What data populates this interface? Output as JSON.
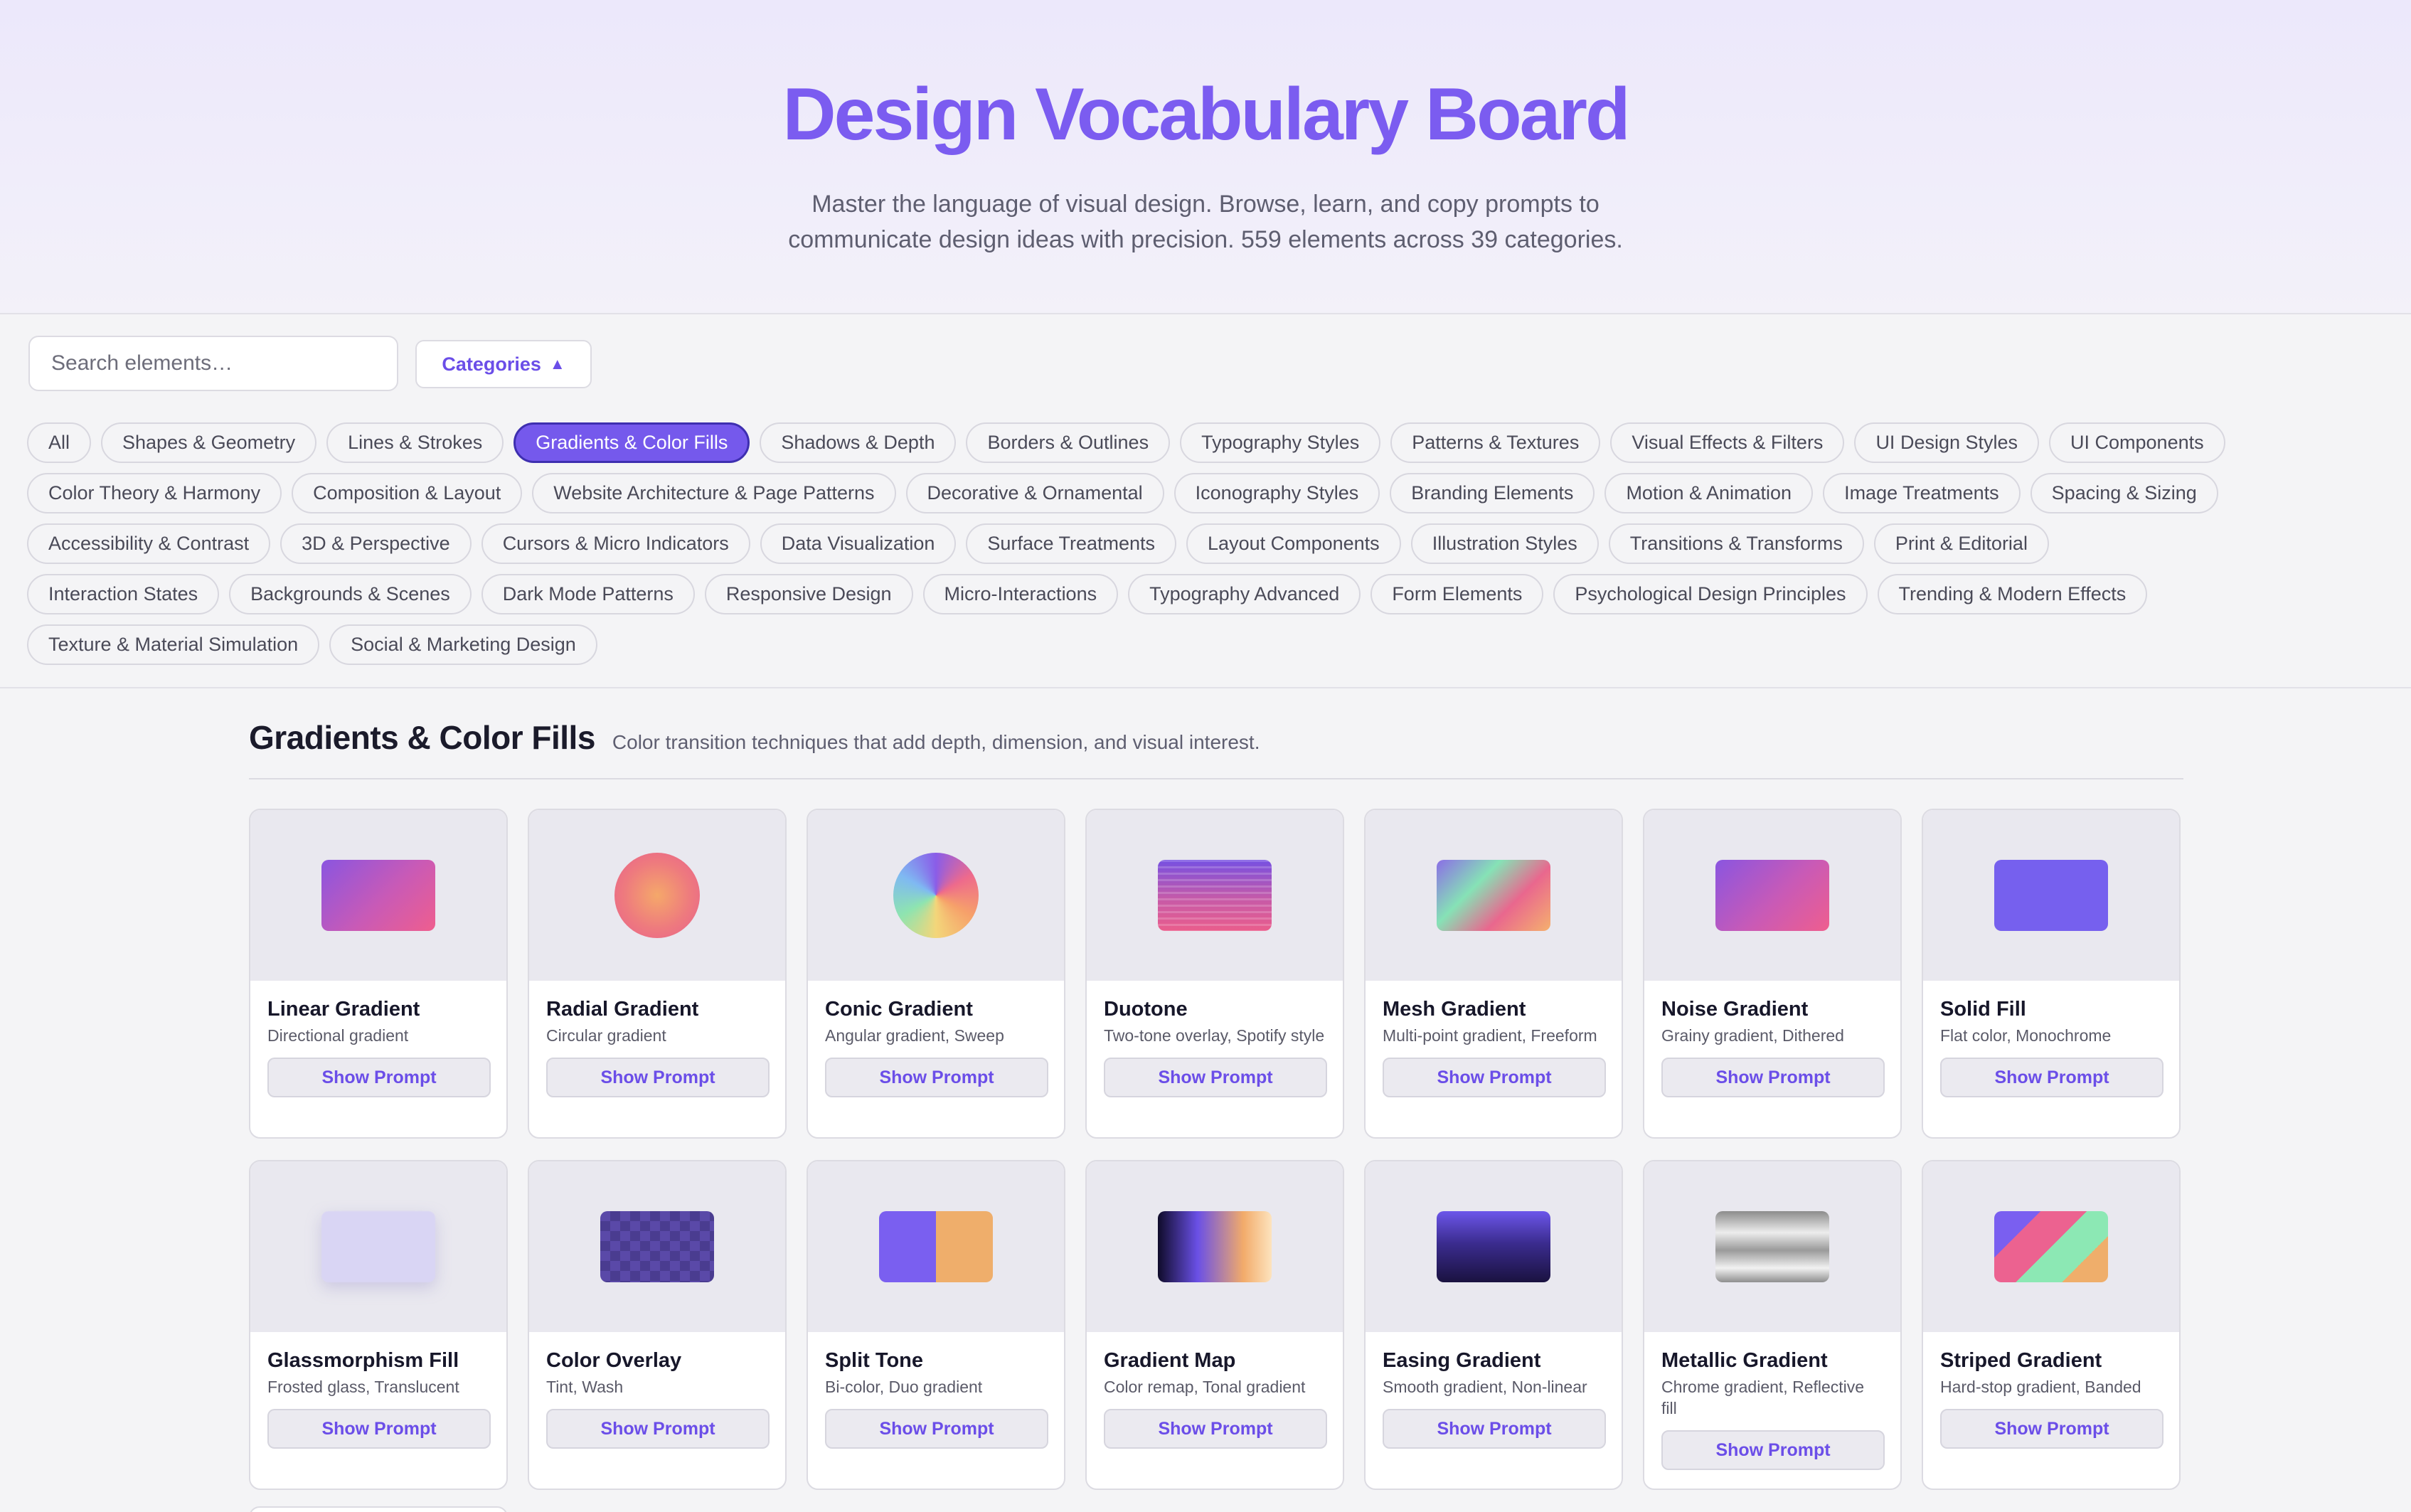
{
  "header": {
    "title": "Design Vocabulary Board",
    "subtitle": "Master the language of visual design. Browse, learn, and copy prompts to communicate design ideas with precision. 559 elements across 39 categories."
  },
  "toolbar": {
    "search_placeholder": "Search elements…",
    "categories_label": "Categories",
    "categories_icon": "▲"
  },
  "categories": [
    "All",
    "Shapes & Geometry",
    "Lines & Strokes",
    "Gradients & Color Fills",
    "Shadows & Depth",
    "Borders & Outlines",
    "Typography Styles",
    "Patterns & Textures",
    "Visual Effects & Filters",
    "UI Design Styles",
    "UI Components",
    "Color Theory & Harmony",
    "Composition & Layout",
    "Website Architecture & Page Patterns",
    "Decorative & Ornamental",
    "Iconography Styles",
    "Branding Elements",
    "Motion & Animation",
    "Image Treatments",
    "Spacing & Sizing",
    "Accessibility & Contrast",
    "3D & Perspective",
    "Cursors & Micro Indicators",
    "Data Visualization",
    "Surface Treatments",
    "Layout Components",
    "Illustration Styles",
    "Transitions & Transforms",
    "Print & Editorial",
    "Interaction States",
    "Backgrounds & Scenes",
    "Dark Mode Patterns",
    "Responsive Design",
    "Micro-Interactions",
    "Typography Advanced",
    "Form Elements",
    "Psychological Design Principles",
    "Trending & Modern Effects",
    "Texture & Material Simulation",
    "Social & Marketing Design"
  ],
  "active_category": "Gradients & Color Fills",
  "section": {
    "title": "Gradients & Color Fills",
    "description": "Color transition techniques that add depth, dimension, and visual interest."
  },
  "button_label": "Show Prompt",
  "cards": [
    {
      "title": "Linear Gradient",
      "subtitle": "Directional gradient",
      "preview": "linear"
    },
    {
      "title": "Radial Gradient",
      "subtitle": "Circular gradient",
      "preview": "radial"
    },
    {
      "title": "Conic Gradient",
      "subtitle": "Angular gradient, Sweep",
      "preview": "conic"
    },
    {
      "title": "Duotone",
      "subtitle": "Two-tone overlay, Spotify style",
      "preview": "duotone"
    },
    {
      "title": "Mesh Gradient",
      "subtitle": "Multi-point gradient, Freeform",
      "preview": "mesh"
    },
    {
      "title": "Noise Gradient",
      "subtitle": "Grainy gradient, Dithered",
      "preview": "noise"
    },
    {
      "title": "Solid Fill",
      "subtitle": "Flat color, Monochrome",
      "preview": "solid"
    },
    {
      "title": "Glassmorphism Fill",
      "subtitle": "Frosted glass, Translucent",
      "preview": "glass"
    },
    {
      "title": "Color Overlay",
      "subtitle": "Tint, Wash",
      "preview": "overlay"
    },
    {
      "title": "Split Tone",
      "subtitle": "Bi-color, Duo gradient",
      "preview": "split"
    },
    {
      "title": "Gradient Map",
      "subtitle": "Color remap, Tonal gradient",
      "preview": "gradmap"
    },
    {
      "title": "Easing Gradient",
      "subtitle": "Smooth gradient, Non-linear",
      "preview": "easing"
    },
    {
      "title": "Metallic Gradient",
      "subtitle": "Chrome gradient, Reflective fill",
      "preview": "metallic"
    },
    {
      "title": "Striped Gradient",
      "subtitle": "Hard-stop gradient, Banded",
      "preview": "striped"
    }
  ],
  "colors": {
    "accent": "#7b5cf0",
    "chip_active": "#7559ec",
    "button_text": "#6b4ee8"
  }
}
